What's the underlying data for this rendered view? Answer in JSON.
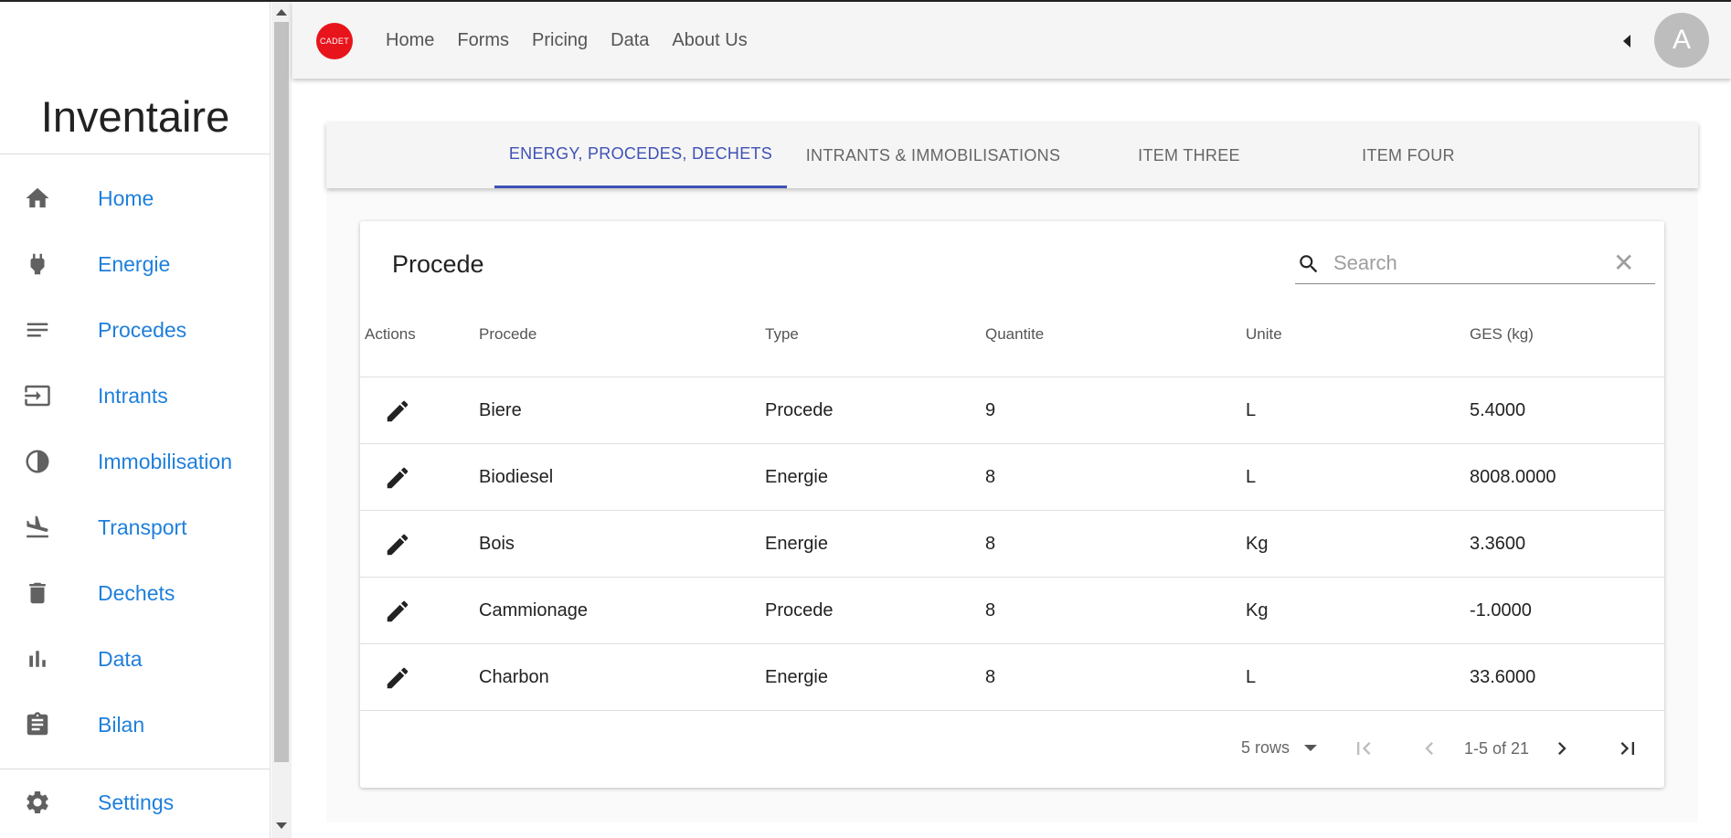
{
  "sidebar": {
    "brand": "Inventaire",
    "items": [
      {
        "label": "Home",
        "icon": "home-icon"
      },
      {
        "label": "Energie",
        "icon": "plug-icon"
      },
      {
        "label": "Procedes",
        "icon": "lines-icon"
      },
      {
        "label": "Intrants",
        "icon": "input-icon"
      },
      {
        "label": "Immobilisation",
        "icon": "contrast-icon"
      },
      {
        "label": "Transport",
        "icon": "airplane-landing-icon"
      },
      {
        "label": "Dechets",
        "icon": "trash-icon"
      },
      {
        "label": "Data",
        "icon": "bar-chart-icon"
      },
      {
        "label": "Bilan",
        "icon": "clipboard-icon"
      }
    ],
    "settings": {
      "label": "Settings",
      "icon": "gear-icon"
    }
  },
  "appbar": {
    "logo_text": "CADET",
    "nav": [
      "Home",
      "Forms",
      "Pricing",
      "Data",
      "About Us"
    ],
    "avatar": "A"
  },
  "tabs": [
    "ENERGY, PROCEDES, DECHETS",
    "INTRANTS & IMMOBILISATIONS",
    "ITEM THREE",
    "ITEM FOUR"
  ],
  "table": {
    "title": "Procede",
    "search_placeholder": "Search",
    "columns": [
      "Actions",
      "Procede",
      "Type",
      "Quantite",
      "Unite",
      "GES (kg)"
    ],
    "rows": [
      {
        "procede": "Biere",
        "type": "Procede",
        "quantite": "9",
        "unite": "L",
        "ges": "5.4000"
      },
      {
        "procede": "Biodiesel",
        "type": "Energie",
        "quantite": "8",
        "unite": "L",
        "ges": "8008.0000"
      },
      {
        "procede": "Bois",
        "type": "Energie",
        "quantite": "8",
        "unite": "Kg",
        "ges": "3.3600"
      },
      {
        "procede": "Cammionage",
        "type": "Procede",
        "quantite": "8",
        "unite": "Kg",
        "ges": "-1.0000"
      },
      {
        "procede": "Charbon",
        "type": "Energie",
        "quantite": "8",
        "unite": "L",
        "ges": "33.6000"
      }
    ],
    "pagination": {
      "rows_per_page": "5 rows",
      "range": "1-5 of 21"
    }
  },
  "colors": {
    "accent": "#3f51b5",
    "link": "#1e7fdc",
    "logo": "#e8141b"
  }
}
